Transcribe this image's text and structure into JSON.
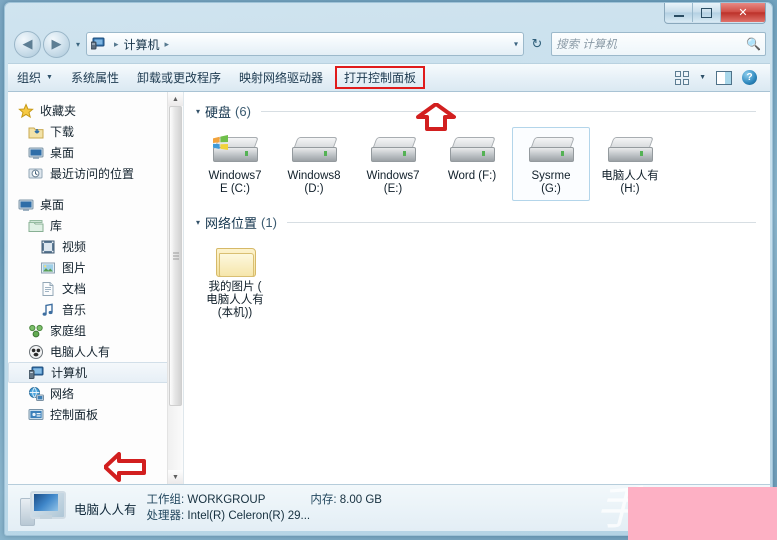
{
  "window": {
    "buttons": {
      "minimize": "minimize-button",
      "maximize": "maximize-button",
      "close": "✕"
    }
  },
  "navigation": {
    "back_glyph": "◀",
    "forward_glyph": "▶",
    "history_glyph": "▾",
    "refresh_glyph": "↻",
    "breadcrumb": {
      "icon": "computer-icon",
      "items": [
        "计算机"
      ],
      "separator": "▸",
      "dropdown_glyph": "▾"
    }
  },
  "search": {
    "placeholder": "搜索 计算机",
    "icon": "search-icon"
  },
  "toolbar": {
    "items": [
      {
        "label": "组织",
        "has_caret": true,
        "highlighted": false
      },
      {
        "label": "系统属性",
        "has_caret": false,
        "highlighted": false
      },
      {
        "label": "卸载或更改程序",
        "has_caret": false,
        "highlighted": false
      },
      {
        "label": "映射网络驱动器",
        "has_caret": false,
        "highlighted": false
      },
      {
        "label": "打开控制面板",
        "has_caret": false,
        "highlighted": true
      }
    ],
    "caret_glyph": "▼",
    "view_dropdown_glyph": "▼",
    "help_label": "?"
  },
  "sidebar": {
    "items": [
      {
        "label": "收藏夹",
        "level": 0,
        "icon": "star-icon",
        "selected": false
      },
      {
        "label": "下载",
        "level": 1,
        "icon": "download-folder-icon",
        "selected": false
      },
      {
        "label": "桌面",
        "level": 1,
        "icon": "desktop-icon",
        "selected": false
      },
      {
        "label": "最近访问的位置",
        "level": 1,
        "icon": "recent-places-icon",
        "selected": false
      },
      {
        "label": "桌面",
        "level": 0,
        "icon": "desktop-icon",
        "selected": false,
        "gap_before": true
      },
      {
        "label": "库",
        "level": 1,
        "icon": "library-icon",
        "selected": false
      },
      {
        "label": "视频",
        "level": 2,
        "icon": "video-icon",
        "selected": false
      },
      {
        "label": "图片",
        "level": 2,
        "icon": "pictures-icon",
        "selected": false
      },
      {
        "label": "文档",
        "level": 2,
        "icon": "documents-icon",
        "selected": false
      },
      {
        "label": "音乐",
        "level": 2,
        "icon": "music-icon",
        "selected": false
      },
      {
        "label": "家庭组",
        "level": 1,
        "icon": "homegroup-icon",
        "selected": false
      },
      {
        "label": "电脑人人有",
        "level": 1,
        "icon": "user-icon",
        "selected": false
      },
      {
        "label": "计算机",
        "level": 1,
        "icon": "computer-icon",
        "selected": true
      },
      {
        "label": "网络",
        "level": 1,
        "icon": "network-icon",
        "selected": false
      },
      {
        "label": "控制面板",
        "level": 1,
        "icon": "control-panel-icon",
        "selected": false
      }
    ],
    "scroll_up_glyph": "▲",
    "scroll_down_glyph": "▼"
  },
  "content": {
    "groups": [
      {
        "title": "硬盘",
        "count": "(6)",
        "triangle": "◢",
        "items": [
          {
            "line1": "Windows7",
            "line2": "E (C:)",
            "icon": "hard-drive-icon",
            "system": true,
            "selected": false
          },
          {
            "line1": "Windows8",
            "line2": "(D:)",
            "icon": "hard-drive-icon",
            "system": false,
            "selected": false
          },
          {
            "line1": "Windows7",
            "line2": "(E:)",
            "icon": "hard-drive-icon",
            "system": false,
            "selected": false
          },
          {
            "line1": "Word (F:)",
            "line2": "",
            "icon": "hard-drive-icon",
            "system": false,
            "selected": false
          },
          {
            "line1": "Sysrme",
            "line2": "(G:)",
            "icon": "hard-drive-icon",
            "system": false,
            "selected": true
          },
          {
            "line1": "电脑人人有",
            "line2": "(H:)",
            "icon": "hard-drive-icon",
            "system": false,
            "selected": false
          }
        ]
      },
      {
        "title": "网络位置",
        "count": "(1)",
        "triangle": "◢",
        "items": [
          {
            "line1": "我的图片 (",
            "line2": "电脑人人有",
            "line3": "(本机))",
            "icon": "folder-icon",
            "system": false,
            "selected": false
          }
        ]
      }
    ]
  },
  "status": {
    "computer_name": "电脑人人有",
    "workgroup_label": "工作组:",
    "workgroup_value": "WORKGROUP",
    "memory_label": "内存:",
    "memory_value": "8.00 GB",
    "processor_label": "处理器:",
    "processor_value": "Intel(R) Celeron(R) 29...",
    "icon": "computer-status-icon"
  },
  "annotations": {
    "highlight_color": "#e01b1b",
    "arrow_up": "red-up-arrow",
    "arrow_left": "red-left-arrow",
    "overlay_color": "#fdb0c4",
    "watermark": "手"
  }
}
